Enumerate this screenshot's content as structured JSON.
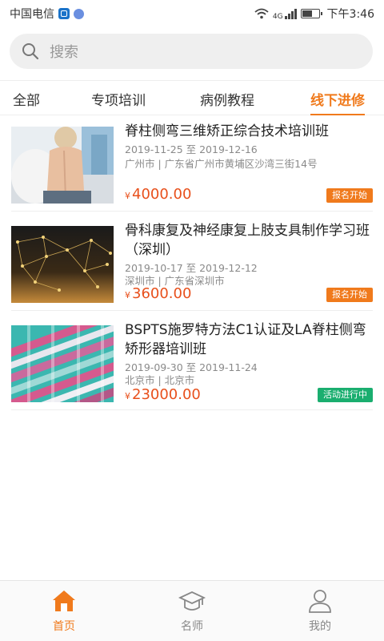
{
  "status_bar": {
    "carrier": "中国电信",
    "network": "4G",
    "time": "下午3:46"
  },
  "search": {
    "placeholder": "搜索"
  },
  "tabs": [
    {
      "label": "全部",
      "active": false
    },
    {
      "label": "专项培训",
      "active": false
    },
    {
      "label": "病例教程",
      "active": false
    },
    {
      "label": "线下进修",
      "active": true
    }
  ],
  "courses": [
    {
      "title": "脊柱侧弯三维矫正综合技术培训班",
      "dates": "2019-11-25 至 2019-12-16",
      "location": "广州市 | 广东省广州市黄埔区沙湾三街14号",
      "currency": "¥",
      "price": "4000.00",
      "status": "报名开始",
      "status_color": "#f07a1c"
    },
    {
      "title": "骨科康复及神经康复上肢支具制作学习班（深圳）",
      "dates": "2019-10-17 至 2019-12-12",
      "location": "深圳市 | 广东省深圳市",
      "currency": "¥",
      "price": "3600.00",
      "status": "报名开始",
      "status_color": "#f07a1c"
    },
    {
      "title": "BSPTS施罗特方法C1认证及LA脊柱侧弯矫形器培训班",
      "dates": "2019-09-30 至 2019-11-24",
      "location": "北京市 | 北京市",
      "currency": "¥",
      "price": "23000.00",
      "status": "活动进行中",
      "status_color": "#1aae6f"
    }
  ],
  "bottom_nav": [
    {
      "label": "首页",
      "icon": "home-icon",
      "active": true
    },
    {
      "label": "名师",
      "icon": "graduation-cap-icon",
      "active": false
    },
    {
      "label": "我的",
      "icon": "user-icon",
      "active": false
    }
  ],
  "colors": {
    "accent": "#f07a1c",
    "price": "#e8501c",
    "active_green": "#1aae6f"
  }
}
